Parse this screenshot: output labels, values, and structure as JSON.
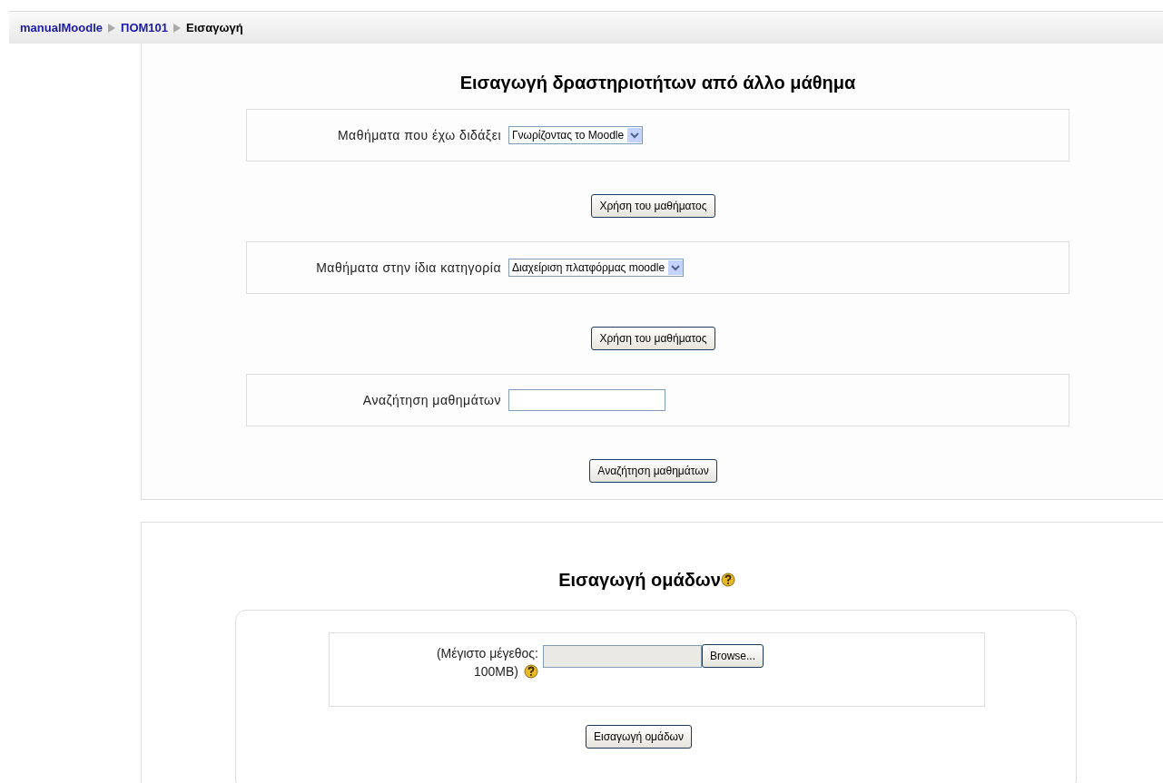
{
  "breadcrumb": [
    {
      "label": "manualMoodle",
      "kind": "link"
    },
    {
      "label": "ΠΟΜ101",
      "kind": "link"
    },
    {
      "label": "Εισαγωγή",
      "kind": "current"
    }
  ],
  "import_activities": {
    "title": "Εισαγωγή δραστηριοτήτων από άλλο μάθημα",
    "rows": [
      {
        "kind": "select",
        "label": "Μαθήματα που έχω διδάξει",
        "value": "Γνωρίζοντας το Moodle",
        "button": "Χρήση του μαθήματος"
      },
      {
        "kind": "select",
        "label": "Μαθήματα στην ίδια κατηγορία",
        "value": "Διαχείριση πλατφόρμας moodle",
        "button": "Χρήση του μαθήματος"
      },
      {
        "kind": "text",
        "label": "Αναζήτηση μαθημάτων",
        "button": "Αναζήτηση μαθημάτων"
      }
    ]
  },
  "import_groups": {
    "title": "Εισαγωγή ομάδων",
    "label_line_1": "(Μέγιστο μέγεθος:",
    "label_line_2": "100MB)",
    "browse_button": "Browse...",
    "submit_button": "Εισαγωγή ομάδων"
  }
}
